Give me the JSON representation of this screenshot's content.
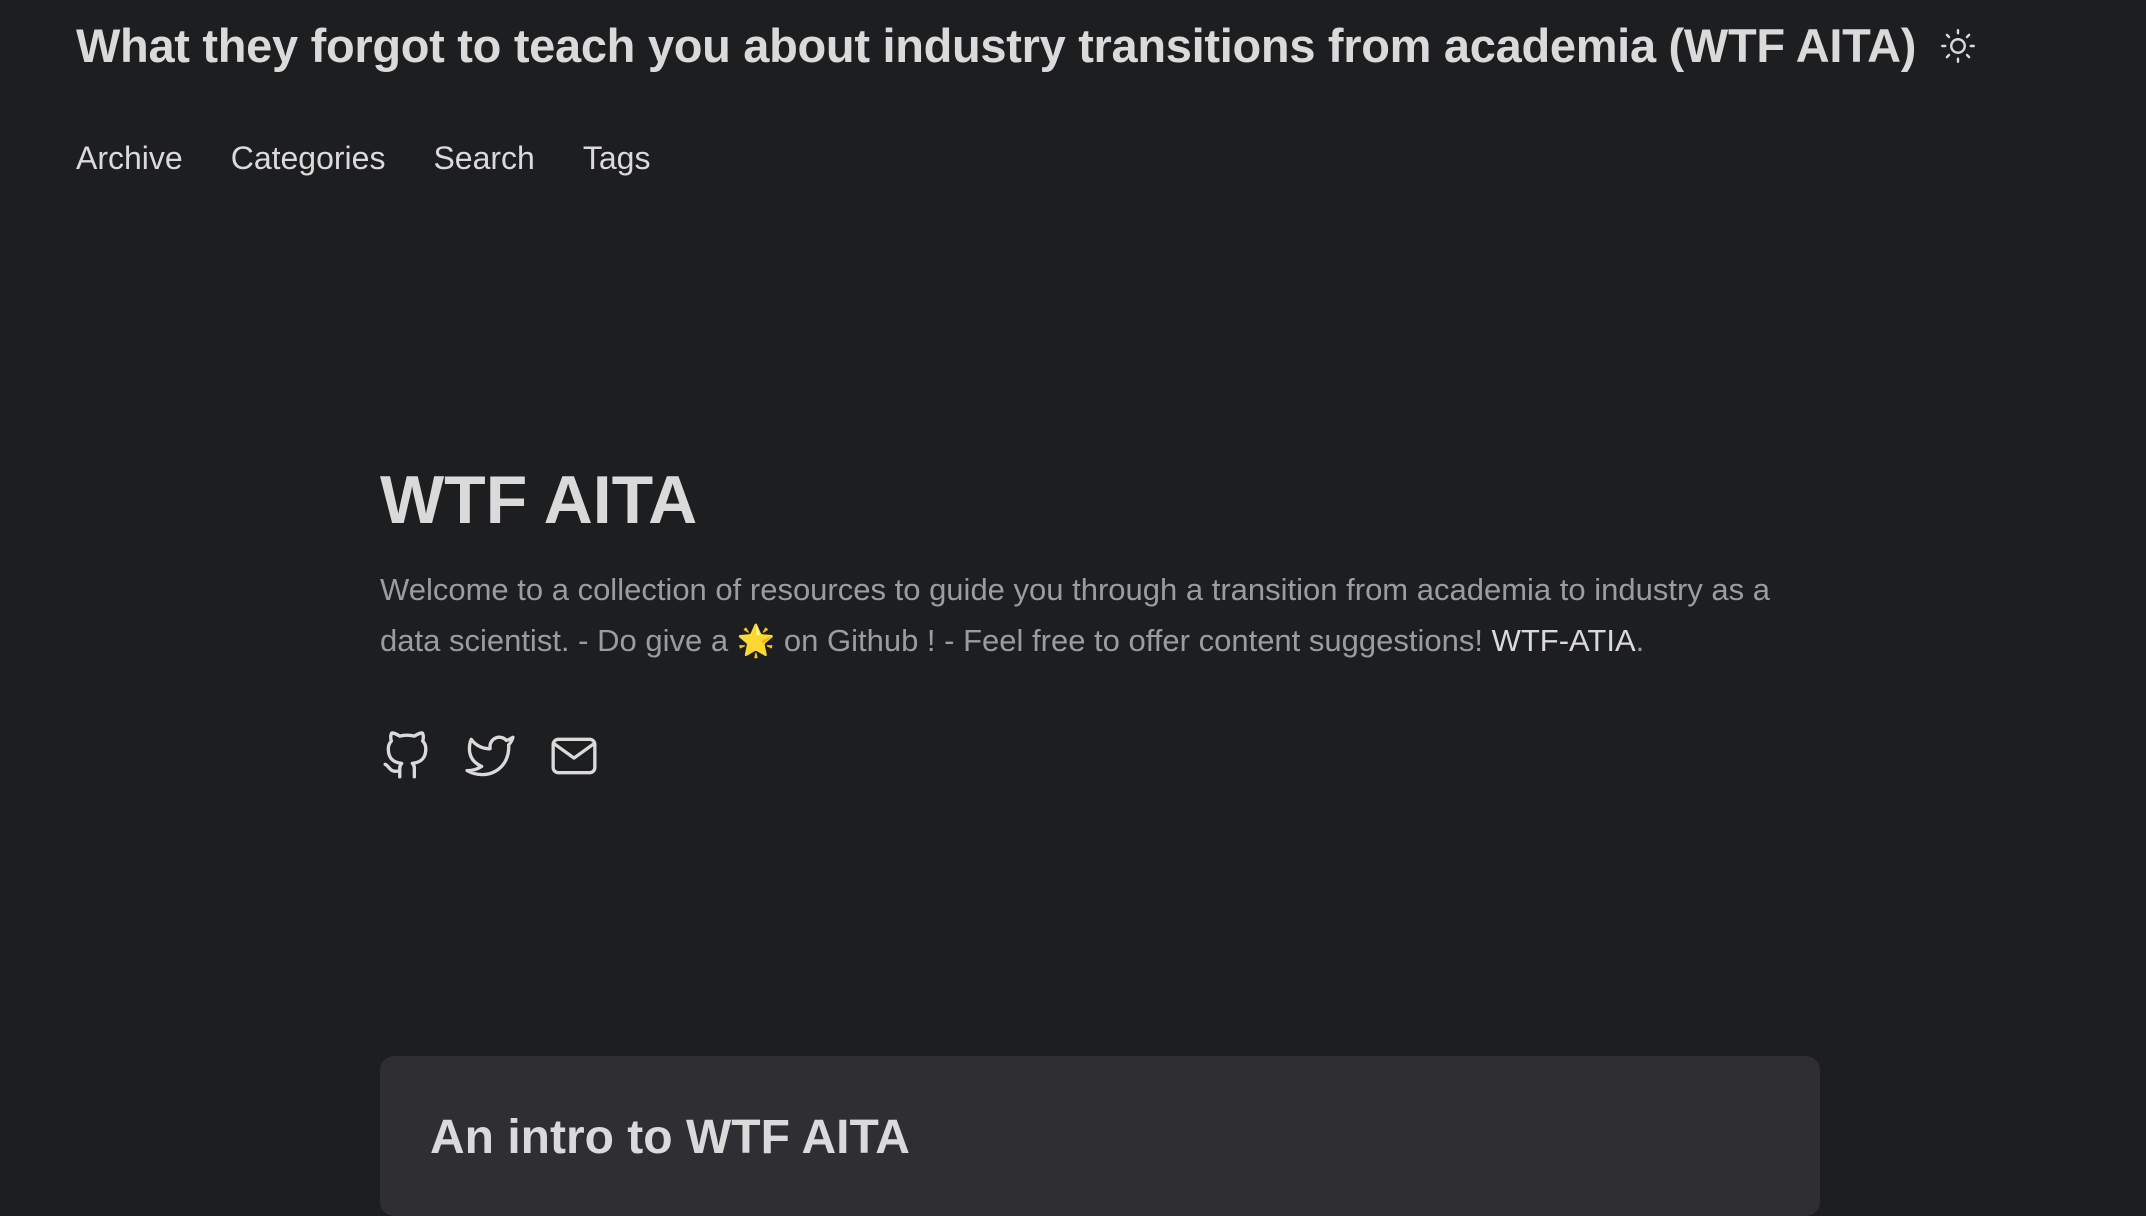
{
  "header": {
    "site_title": "What they forgot to teach you about industry transitions from academia (WTF AITA)",
    "theme_icon": "sun-icon",
    "nav": [
      {
        "label": "Archive"
      },
      {
        "label": "Categories"
      },
      {
        "label": "Search"
      },
      {
        "label": "Tags"
      }
    ]
  },
  "home": {
    "title": "WTF AITA",
    "description_before_star": "Welcome to a collection of resources to guide you through a transition from academia to industry as a data scientist. - Do give a ",
    "star_glyph": "🌟",
    "description_after_star": " on Github ! - Feel free to offer content suggestions! ",
    "repo_link": "WTF-ATIA",
    "description_end": ".",
    "social_icons": [
      "github-icon",
      "twitter-icon",
      "email-icon"
    ]
  },
  "posts": [
    {
      "title": "An intro to WTF AITA"
    }
  ],
  "colors": {
    "background": "#1d1e20",
    "card": "#2e2e33",
    "primary_text": "#dadadb",
    "secondary_text": "#9b9c9d"
  }
}
